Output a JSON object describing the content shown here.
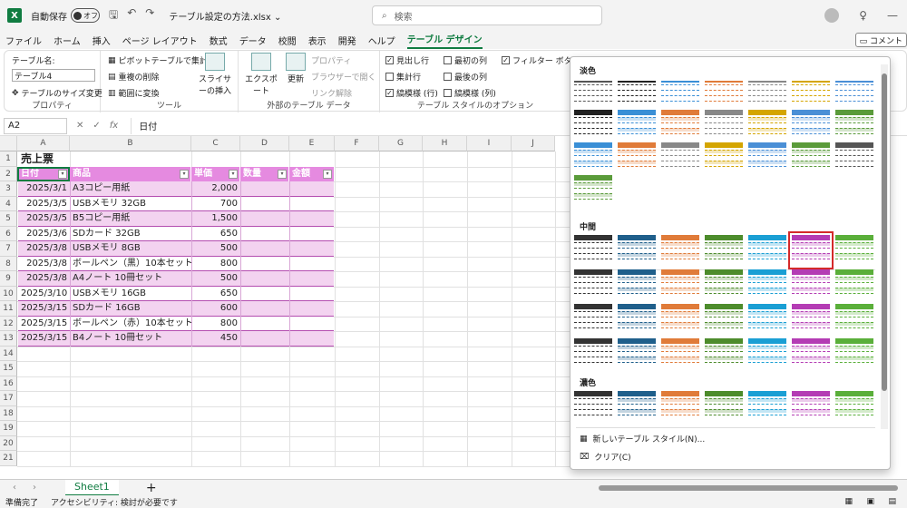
{
  "title": {
    "app_icon": "X",
    "autosave": "自動保存",
    "toggle": "オフ",
    "filename": "テーブル設定の方法.xlsx ⌄",
    "search": "検索"
  },
  "menu": [
    "ファイル",
    "ホーム",
    "挿入",
    "ページ レイアウト",
    "数式",
    "データ",
    "校閲",
    "表示",
    "開発",
    "ヘルプ",
    "テーブル デザイン"
  ],
  "comment": "コメント",
  "ribbon": {
    "tablename_label": "テーブル名:",
    "tablename": "テーブル4",
    "resize": "テーブルのサイズ変更",
    "g1": "プロパティ",
    "pivot": "ピボットテーブルで集計",
    "dedupe": "重複の削除",
    "convert": "範囲に変換",
    "slicer": "スライサーの挿入",
    "g2": "ツール",
    "export": "エクスポート",
    "refresh": "更新",
    "props": "プロパティ",
    "browser": "ブラウザーで開く",
    "unlink": "リンク解除",
    "g3": "外部のテーブル データ",
    "opt_header": "見出し行",
    "opt_total": "集計行",
    "opt_banded": "縞模様 (行)",
    "opt_first": "最初の列",
    "opt_last": "最後の列",
    "opt_bandcol": "縞模様 (列)",
    "opt_filter": "フィルター ボタン",
    "g4": "テーブル スタイルのオプション"
  },
  "formula": {
    "cell": "A2",
    "value": "日付"
  },
  "columns": [
    "A",
    "B",
    "C",
    "D",
    "E",
    "F",
    "G",
    "H",
    "I",
    "J"
  ],
  "rows": [
    "1",
    "2",
    "3",
    "4",
    "5",
    "6",
    "7",
    "8",
    "9",
    "10",
    "11",
    "12",
    "13",
    "14",
    "15",
    "16",
    "17",
    "18",
    "19",
    "20",
    "21"
  ],
  "sheet_title": "売上票",
  "headers": [
    "日付",
    "商品",
    "単価",
    "数量",
    "金額"
  ],
  "data": [
    [
      "2025/3/1",
      "A3コピー用紙",
      "2,000"
    ],
    [
      "2025/3/5",
      "USBメモリ 32GB",
      "700"
    ],
    [
      "2025/3/5",
      "B5コピー用紙",
      "1,500"
    ],
    [
      "2025/3/6",
      "SDカード 32GB",
      "650"
    ],
    [
      "2025/3/8",
      "USBメモリ 8GB",
      "500"
    ],
    [
      "2025/3/8",
      "ボールペン（黒）10本セット",
      "800"
    ],
    [
      "2025/3/8",
      "A4ノート 10冊セット",
      "500"
    ],
    [
      "2025/3/10",
      "USBメモリ 16GB",
      "650"
    ],
    [
      "2025/3/15",
      "SDカード 16GB",
      "600"
    ],
    [
      "2025/3/15",
      "ボールペン（赤）10本セット",
      "800"
    ],
    [
      "2025/3/15",
      "B4ノート 10冊セット",
      "450"
    ]
  ],
  "gallery": {
    "light": "淡色",
    "medium": "中間",
    "dark": "濃色",
    "new_style": "新しいテーブル スタイル(N)...",
    "clear": "クリア(C)"
  },
  "sheet_tab": "Sheet1",
  "status": {
    "ready": "準備完了",
    "access": "アクセシビリティ: 検討が必要です"
  },
  "colors": {
    "accent": "#107c41",
    "table_header": "#e58ae0",
    "table_band": "#f3d3f0",
    "selected_outline": "#d42a2a"
  }
}
